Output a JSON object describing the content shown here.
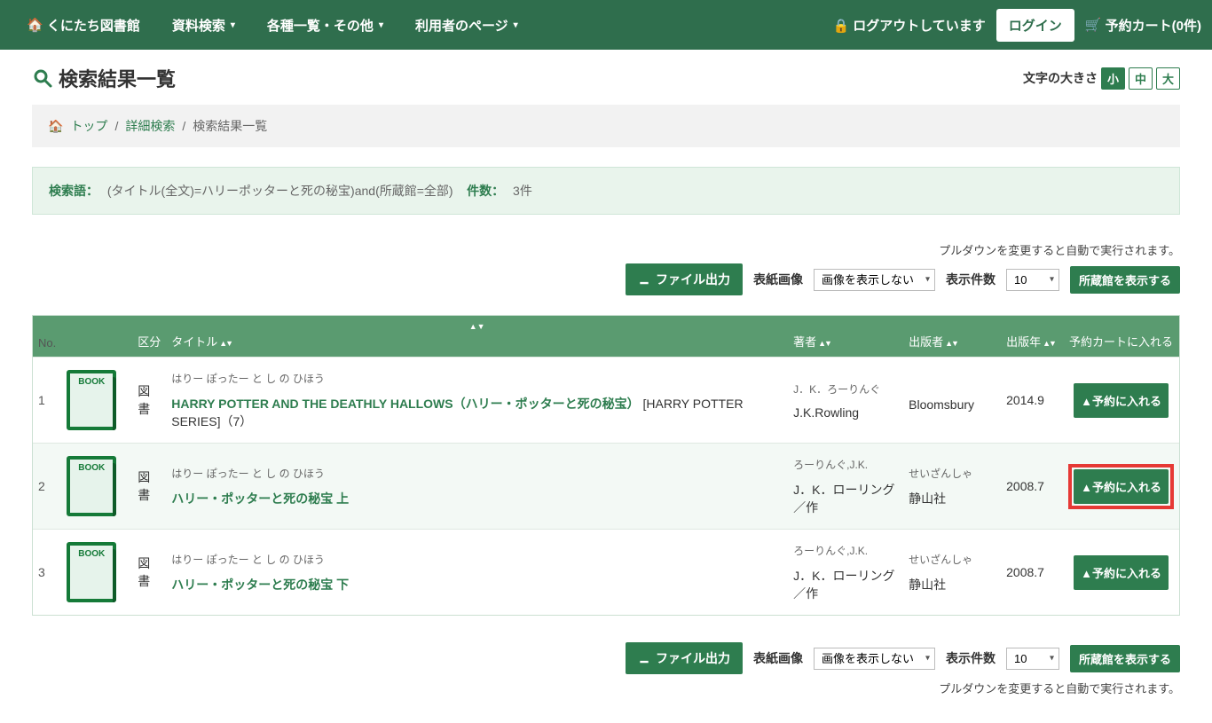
{
  "navbar": {
    "brand": "くにたち図書館",
    "menu": [
      "資料検索",
      "各種一覧・その他",
      "利用者のページ"
    ],
    "logout_text": "ログアウトしています",
    "login": "ログイン",
    "cart": "予約カート(0件)"
  },
  "page": {
    "title": "検索結果一覧",
    "font_size_label": "文字の大きさ",
    "font_sizes": [
      "小",
      "中",
      "大"
    ],
    "font_size_active": 0
  },
  "breadcrumb": {
    "top": "トップ",
    "detail": "詳細検索",
    "current": "検索結果一覧"
  },
  "search_info": {
    "label_query": "検索語：",
    "query": "(タイトル(全文)=ハリーポッターと死の秘宝)and(所蔵館=全部)",
    "label_count": "件数：",
    "count": "3件"
  },
  "ctrl": {
    "note": "プルダウンを変更すると自動で実行されます。",
    "file_output": "ファイル出力",
    "cover_label": "表紙画像",
    "cover_value": "画像を表示しない",
    "count_label": "表示件数",
    "count_value": "10",
    "show_holdings": "所蔵館を表示する"
  },
  "table": {
    "headers": {
      "no": "No.",
      "type": "区分",
      "title": "タイトル",
      "author": "著者",
      "publisher": "出版者",
      "year": "出版年",
      "cart": "予約カートに入れる"
    },
    "rows": [
      {
        "no": "1",
        "type": "図書",
        "kana": "はりー ぽったー と し の ひほう",
        "title": "HARRY POTTER AND THE DEATHLY HALLOWS（ハリー・ポッターと死の秘宝）",
        "title_extra": "   [HARRY POTTER SERIES]（7）",
        "author_kana": "J．K．ろーりんぐ",
        "author": "J.K.Rowling",
        "publisher_kana": "",
        "publisher": "Bloomsbury",
        "year": "2014.9",
        "reserve": "▲予約に入れる",
        "highlight": false
      },
      {
        "no": "2",
        "type": "図書",
        "kana": "はりー ぽったー と し の ひほう",
        "title": "ハリー・ポッターと死の秘宝 上",
        "title_extra": "",
        "author_kana": "ろーりんぐ,J.K.",
        "author": "J．K．ローリング／作",
        "publisher_kana": "せいざんしゃ",
        "publisher": "静山社",
        "year": "2008.7",
        "reserve": "▲予約に入れる",
        "highlight": true
      },
      {
        "no": "3",
        "type": "図書",
        "kana": "はりー ぽったー と し の ひほう",
        "title": "ハリー・ポッターと死の秘宝 下",
        "title_extra": "",
        "author_kana": "ろーりんぐ,J.K.",
        "author": "J．K．ローリング／作",
        "publisher_kana": "せいざんしゃ",
        "publisher": "静山社",
        "year": "2008.7",
        "reserve": "▲予約に入れる",
        "highlight": false
      }
    ]
  }
}
